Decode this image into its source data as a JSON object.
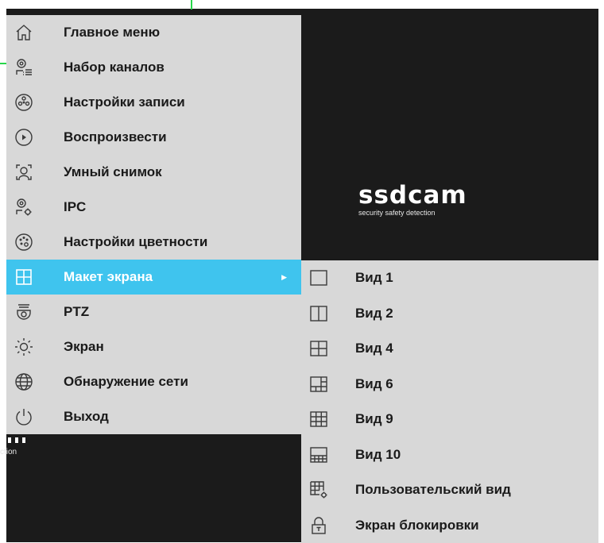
{
  "brand": {
    "name": "ssdcam",
    "tagline": "security safety detection"
  },
  "background_fragment": {
    "text": "ction"
  },
  "colors": {
    "highlight": "#3fc4ee",
    "menu_bg": "#d8d8d8",
    "screen_bg": "#1b1b1b",
    "accent_green": "#27d64a"
  },
  "menu": {
    "items": [
      {
        "label": "Главное меню",
        "icon": "home-icon"
      },
      {
        "label": "Набор каналов",
        "icon": "channel-set-icon"
      },
      {
        "label": "Настройки записи",
        "icon": "record-reel-icon"
      },
      {
        "label": "Воспроизвести",
        "icon": "play-icon"
      },
      {
        "label": "Умный снимок",
        "icon": "face-capture-icon"
      },
      {
        "label": "IPC",
        "icon": "ipc-camera-settings-icon"
      },
      {
        "label": "Настройки цветности",
        "icon": "palette-icon"
      },
      {
        "label": "Макет экрана",
        "icon": "grid-layout-icon",
        "active": true
      },
      {
        "label": "PTZ",
        "icon": "ptz-camera-icon"
      },
      {
        "label": "Экран",
        "icon": "brightness-icon"
      },
      {
        "label": "Обнаружение сети",
        "icon": "globe-icon"
      },
      {
        "label": "Выход",
        "icon": "power-icon"
      }
    ]
  },
  "submenu": {
    "items": [
      {
        "label": "Вид 1",
        "icon": "layout-1-icon"
      },
      {
        "label": "Вид 2",
        "icon": "layout-2-icon"
      },
      {
        "label": "Вид 4",
        "icon": "layout-4-icon"
      },
      {
        "label": "Вид 6",
        "icon": "layout-6-icon"
      },
      {
        "label": "Вид 9",
        "icon": "layout-9-icon"
      },
      {
        "label": "Вид 10",
        "icon": "layout-10-icon"
      },
      {
        "label": "Пользовательский вид",
        "icon": "custom-layout-icon"
      },
      {
        "label": "Экран блокировки",
        "icon": "lock-screen-icon"
      }
    ]
  }
}
